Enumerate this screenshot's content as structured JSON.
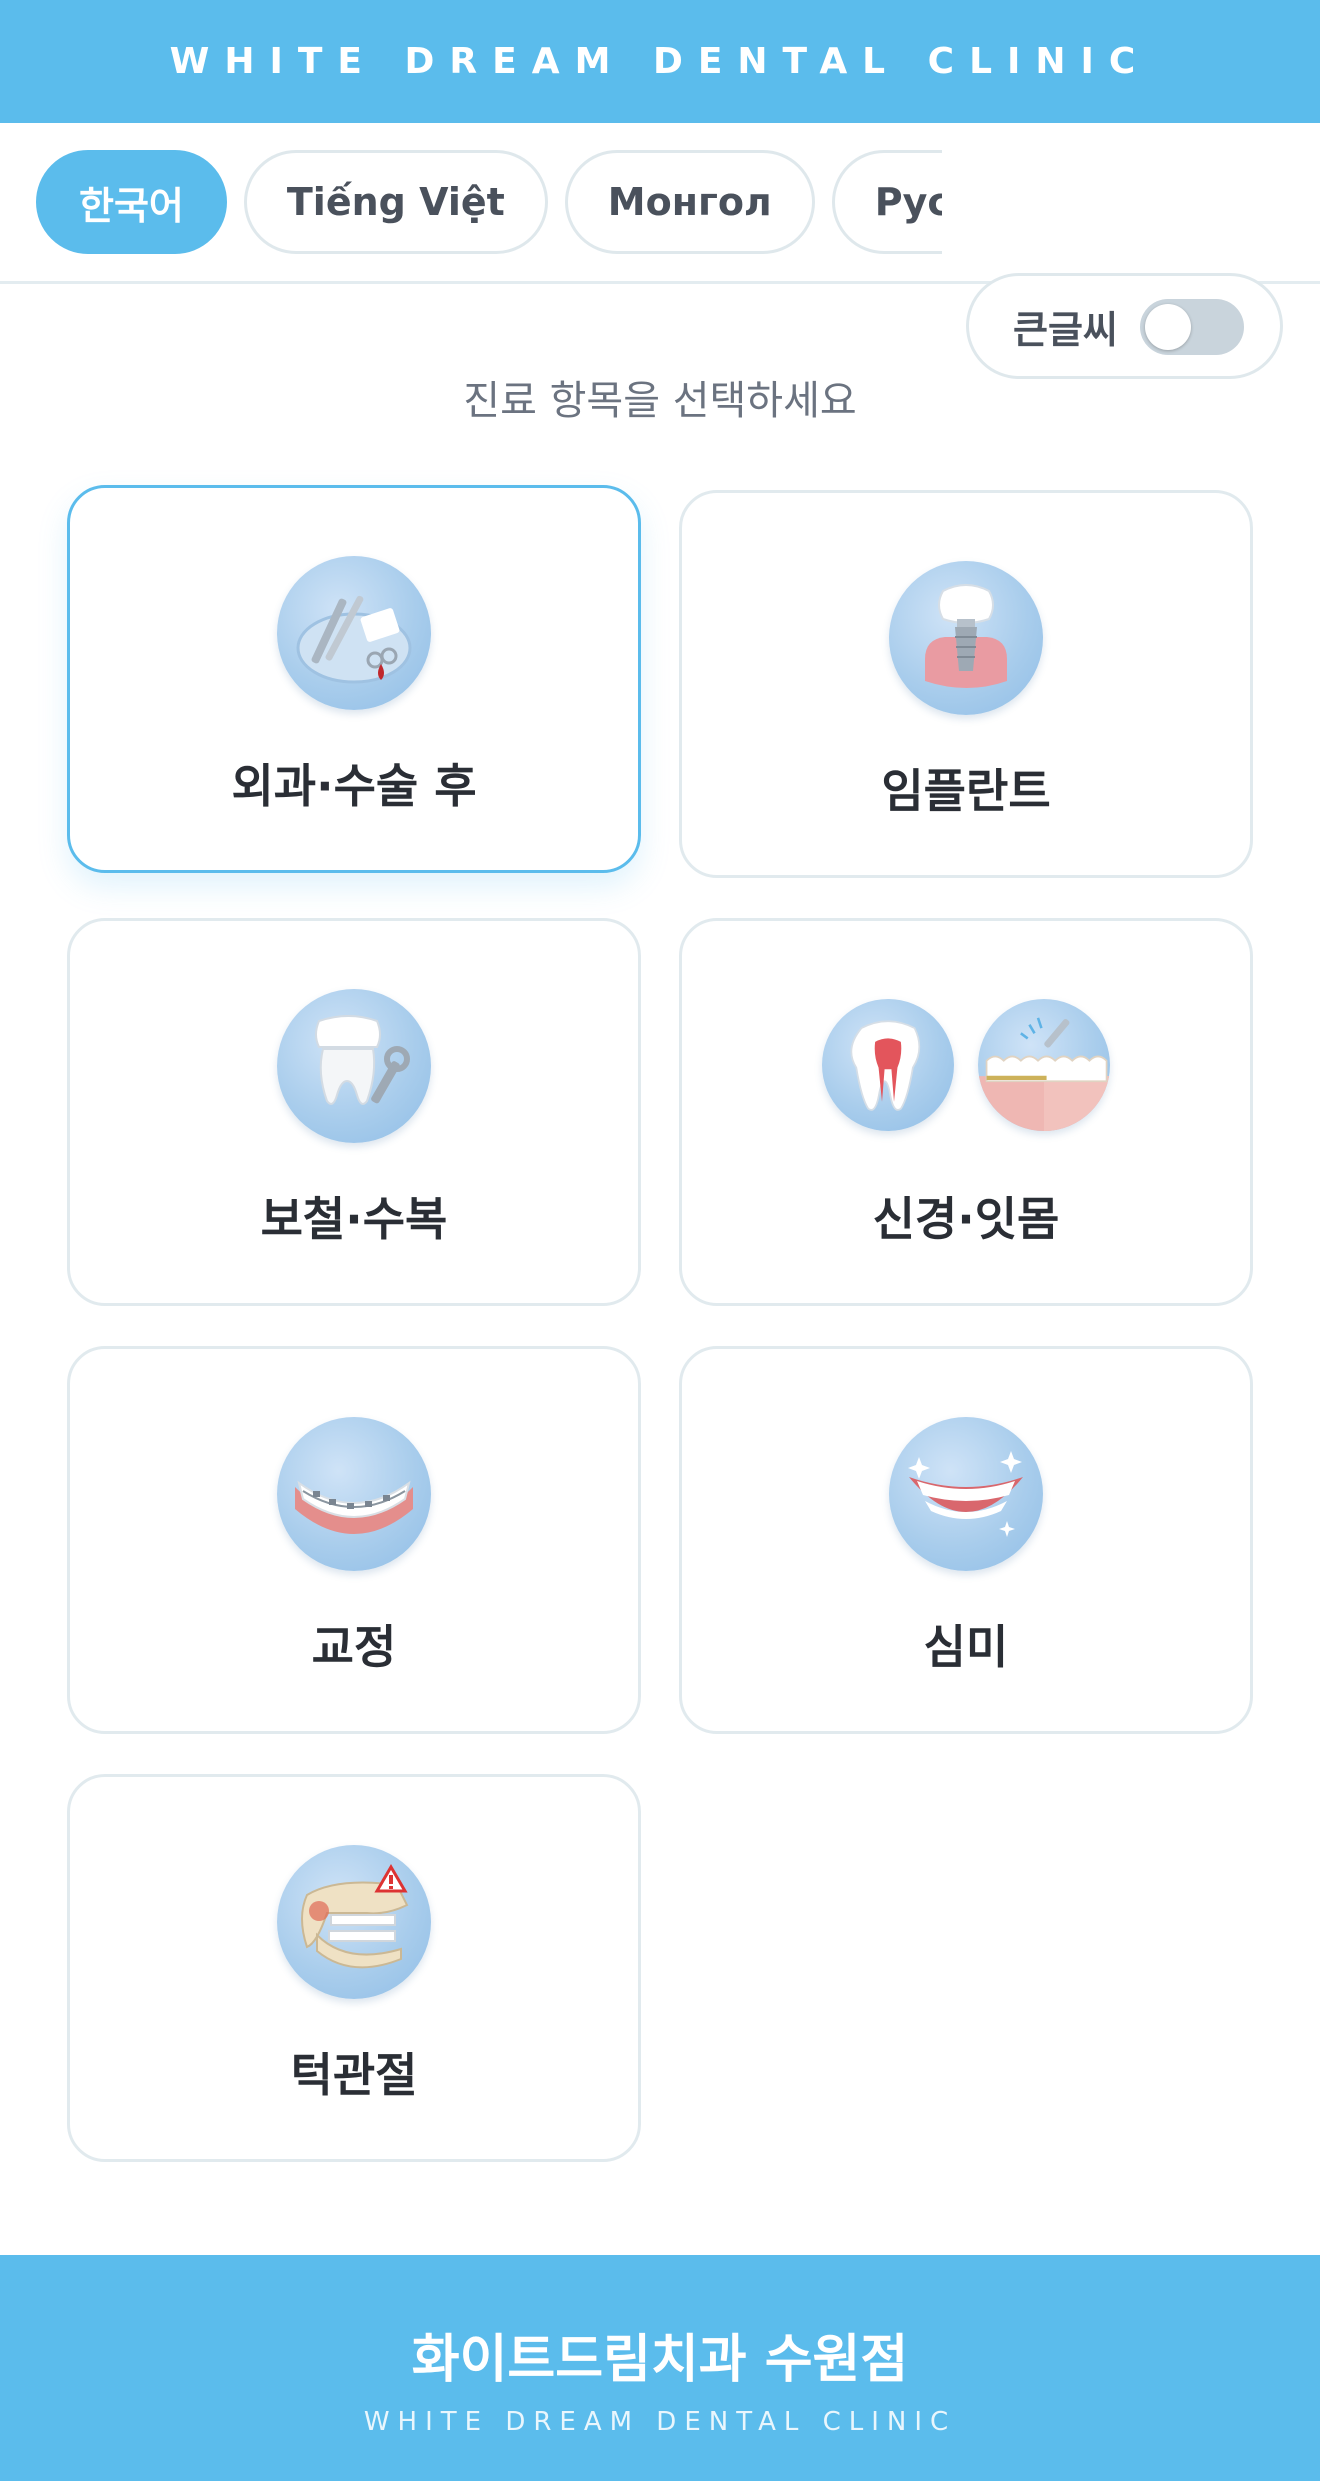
{
  "header": {
    "brand": "WHITE DREAM DENTAL CLINIC"
  },
  "languages": {
    "items": [
      {
        "label": "한국어",
        "active": true
      },
      {
        "label": "Tiếng Việt",
        "active": false
      },
      {
        "label": "Монгол",
        "active": false
      },
      {
        "label": "Русский",
        "active": false
      }
    ],
    "big_text": {
      "label": "큰글씨",
      "enabled": false
    }
  },
  "main": {
    "subtitle": "진료 항목을 선택하세요",
    "categories": [
      {
        "label": "외과·수술 후",
        "icon": "surgical-tools-icon",
        "selected": true
      },
      {
        "label": "임플란트",
        "icon": "implant-icon",
        "selected": false
      },
      {
        "label": "보철·수복",
        "icon": "crown-wrench-icon",
        "selected": false
      },
      {
        "label": "신경·잇몸",
        "icon": "root-canal-gum-icon",
        "selected": false
      },
      {
        "label": "교정",
        "icon": "braces-icon",
        "selected": false
      },
      {
        "label": "심미",
        "icon": "smile-icon",
        "selected": false
      },
      {
        "label": "턱관절",
        "icon": "jaw-joint-icon",
        "selected": false
      }
    ]
  },
  "footer": {
    "name": "화이트드림치과 수원점",
    "sub": "WHITE DREAM DENTAL CLINIC"
  },
  "colors": {
    "accent": "#5bbcec",
    "border": "#e1eaee",
    "text": "#2a2e35"
  }
}
